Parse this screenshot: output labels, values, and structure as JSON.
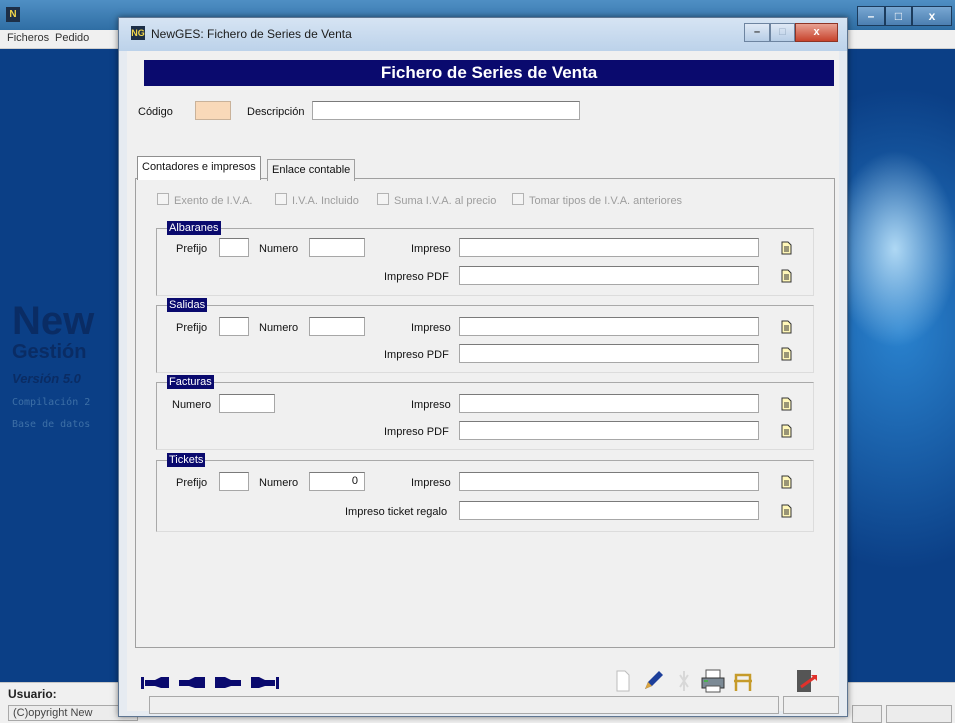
{
  "background_app": {
    "menu": [
      "Ficheros",
      "Pedido"
    ],
    "splash": {
      "title_partial": "New",
      "subtitle_partial": "Gestión",
      "version": "Versión 5.0",
      "compilation_partial": "Compilación 2",
      "database_partial": "Base de datos"
    },
    "status": {
      "user_label": "Usuario:",
      "copyright_partial": "(C)opyright New"
    }
  },
  "dialog": {
    "title": "NewGES: Fichero de Series de Venta",
    "icon_text": "NG",
    "header": "Fichero de Series de Venta",
    "codigo_label": "Código",
    "codigo_value": "",
    "descripcion_label": "Descripción",
    "descripcion_value": "",
    "tabs": [
      {
        "label": "Contadores e impresos",
        "active": true
      },
      {
        "label": "Enlace contable",
        "active": false
      }
    ],
    "checkboxes": [
      {
        "label": "Exento de I.V.A.",
        "checked": false
      },
      {
        "label": "I.V.A. Incluido",
        "checked": false
      },
      {
        "label": "Suma I.V.A. al precio",
        "checked": false
      },
      {
        "label": "Tomar tipos de I.V.A. anteriores",
        "checked": false
      }
    ],
    "groups": {
      "albaranes": {
        "title": "Albaranes",
        "prefijo_label": "Prefijo",
        "prefijo": "",
        "numero_label": "Numero",
        "numero": "",
        "impreso_label": "Impreso",
        "impreso": "",
        "impreso_pdf_label": "Impreso PDF",
        "impreso_pdf": ""
      },
      "salidas": {
        "title": "Salidas",
        "prefijo_label": "Prefijo",
        "prefijo": "",
        "numero_label": "Numero",
        "numero": "",
        "impreso_label": "Impreso",
        "impreso": "",
        "impreso_pdf_label": "Impreso PDF",
        "impreso_pdf": ""
      },
      "facturas": {
        "title": "Facturas",
        "numero_label": "Numero",
        "numero": "",
        "impreso_label": "Impreso",
        "impreso": "",
        "impreso_pdf_label": "Impreso PDF",
        "impreso_pdf": ""
      },
      "tickets": {
        "title": "Tickets",
        "prefijo_label": "Prefijo",
        "prefijo": "",
        "numero_label": "Numero",
        "numero": "0",
        "impreso_label": "Impreso",
        "impreso": "",
        "impreso_regalo_label": "Impreso ticket regalo",
        "impreso_regalo": ""
      }
    },
    "icons": {
      "file": "document-icon",
      "nav": [
        "first-record-icon",
        "previous-record-icon",
        "next-record-icon",
        "last-record-icon"
      ],
      "actions": [
        "new-document-icon",
        "edit-pen-icon",
        "delete-icon",
        "print-icon",
        "chair-icon",
        "exit-icon"
      ]
    },
    "colors": {
      "header_bg": "#0a0a6e",
      "codigo_bg": "#f9d9b9",
      "nav_arrows": "#0a0a6e"
    }
  }
}
